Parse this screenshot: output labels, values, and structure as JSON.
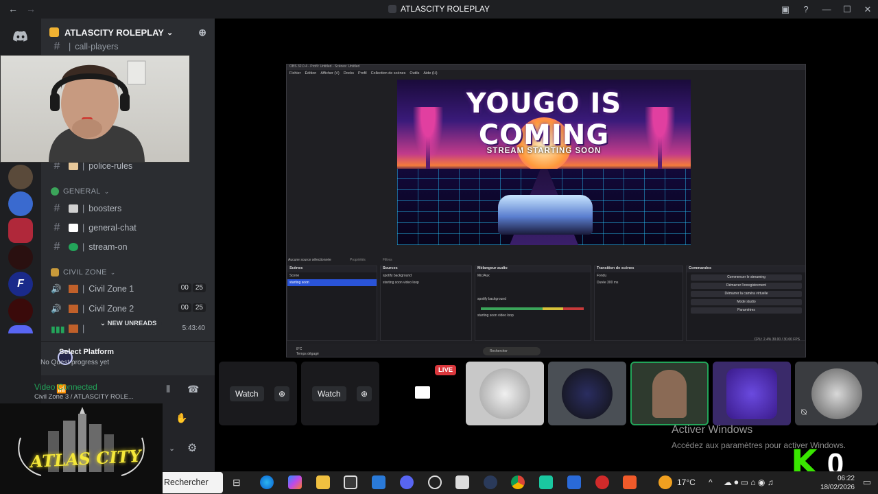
{
  "titlebar": {
    "server_name": "ATLASCITY ROLEPLAY",
    "nav_back": "←",
    "nav_forward": "→"
  },
  "server": {
    "name": "ATLASCITY ROLEPLAY",
    "chevron": "⌄"
  },
  "channels": {
    "call_players": "call-players",
    "police_rules": "police-rules",
    "general_category": "GENERAL",
    "boosters": "boosters",
    "general_chat": "general-chat",
    "stream_on": "stream-on",
    "civil_zone_category": "CIVIL ZONE",
    "civil_zone_1": "Civil Zone 1",
    "civil_zone_2": "Civil Zone 2",
    "civil_zone_1_badge_a": "00",
    "civil_zone_1_badge_b": "25",
    "civil_zone_2_badge_a": "00",
    "civil_zone_2_badge_b": "25",
    "new_unreads": "NEW UNREADS",
    "timer": "5:43:40"
  },
  "quest": {
    "title": "Select Platform",
    "subtitle": "No Quest progress yet"
  },
  "voice": {
    "status": "Video Connected",
    "location": "Civil Zone 3 / ATLASCITY ROLE..."
  },
  "obs": {
    "title": "OBS 32.0.4 - Profil: Untitled - Scènes: Untitled",
    "menu": [
      "Fichier",
      "Édition",
      "Afficher (V)",
      "Docks",
      "Profil",
      "Collection de scènes",
      "Outils",
      "Aide (H)"
    ],
    "headline": "YOUGO IS COMING",
    "subheadline": "STREAM STARTING SOON",
    "no_source": "Aucune source sélectionnée",
    "props": "Propriétés",
    "filters": "Filtres",
    "docks": {
      "scenes_title": "Scènes",
      "scenes": [
        "Scene",
        "starting soon"
      ],
      "sources_title": "Sources",
      "sources": [
        "spotify background",
        "starting soon video loop"
      ],
      "mixer_title": "Mélangeur audio",
      "mixer": [
        "Mic/Aux",
        "spotify background",
        "starting soon video loop"
      ],
      "transitions_title": "Transition de scènes",
      "transition": "Fondu",
      "duration_label": "Durée",
      "duration": "300 ms",
      "controls_title": "Commandes",
      "controls": [
        "Commencer le streaming",
        "Démarrer l'enregistrement",
        "Démarrer la caméra virtuelle",
        "Mode studio",
        "Paramètres"
      ]
    },
    "status": "CPU: 2.4%   30.00 / 30.00 FPS",
    "search": "Rechercher",
    "weather": "8°C",
    "weather_sub": "Temps dégagé"
  },
  "tiles": {
    "watch_label": "Watch",
    "live_label": "LIVE"
  },
  "activate_windows": {
    "title": "Activer Windows",
    "subtitle": "Accédez aux paramètres pour activer Windows."
  },
  "overlay": {
    "k_letter": "K",
    "zero": "0",
    "logo_text": "ATLAS CITY"
  },
  "taskbar": {
    "search": "Rechercher",
    "weather": "17°C",
    "time": "06:22",
    "date": "18/02/2026"
  }
}
